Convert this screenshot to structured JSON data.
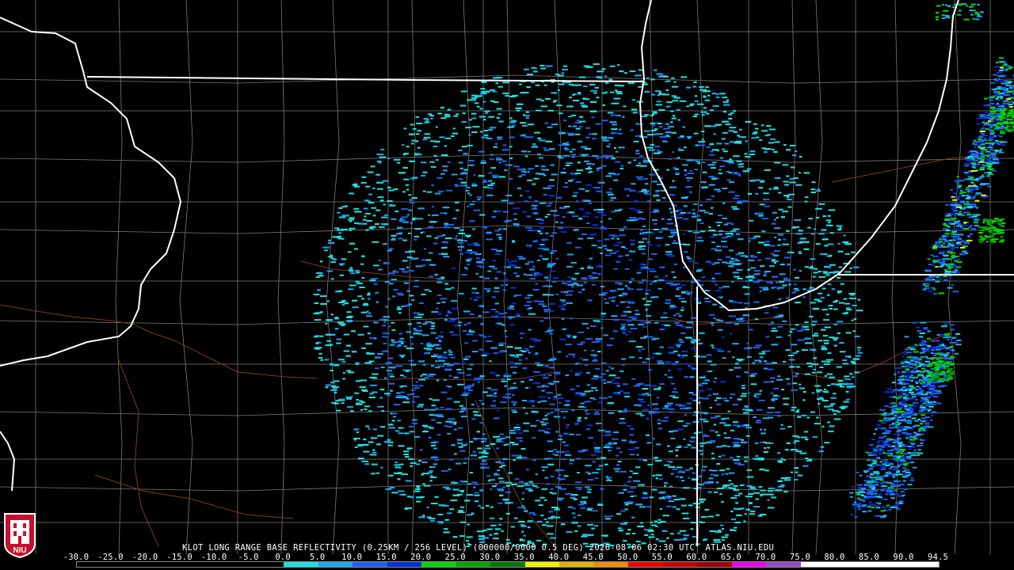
{
  "product_label": "KLOT LONG RANGE BASE REFLECTIVITY (0.25KM / 256 LEVEL) (000000/0000 0.5 DEG) 2026-08-06 02:30 UTC  ATLAS.NIU.EDU",
  "logo_text": "NIU",
  "colorbar_ticks": [
    "-30.0",
    "-25.0",
    "-20.0",
    "-15.0",
    "-10.0",
    "-5.0",
    "0.0",
    "5.0",
    "10.0",
    "15.0",
    "20.0",
    "25.0",
    "30.0",
    "35.0",
    "40.0",
    "45.0",
    "50.0",
    "55.0",
    "60.0",
    "65.0",
    "70.0",
    "75.0",
    "80.0",
    "85.0",
    "90.0",
    "94.5"
  ],
  "colorbar_colors": [
    "#000000",
    "#000000",
    "#000000",
    "#000000",
    "#000000",
    "#000000",
    "#1ce0e0",
    "#1ca8f0",
    "#1c60f0",
    "#0030d8",
    "#00d800",
    "#00a800",
    "#007800",
    "#f0f000",
    "#e0b400",
    "#f08c00",
    "#f00000",
    "#c80000",
    "#a00000",
    "#f000f0",
    "#9848c8",
    "#ffffff",
    "#ffffff",
    "#ffffff",
    "#ffffff"
  ],
  "radar_colors": {
    "light_cyan": "#1ce0e0",
    "sky_blue": "#1ca8f0",
    "blue": "#1c60f0",
    "dark_blue": "#0030d8",
    "green": "#00d800",
    "dark_green": "#00a800",
    "yellow": "#f0f000"
  },
  "map_colors": {
    "state_border": "#ffffff",
    "county_line": "#8a8a8a",
    "river": "#8a4a2a",
    "background": "#000000"
  }
}
